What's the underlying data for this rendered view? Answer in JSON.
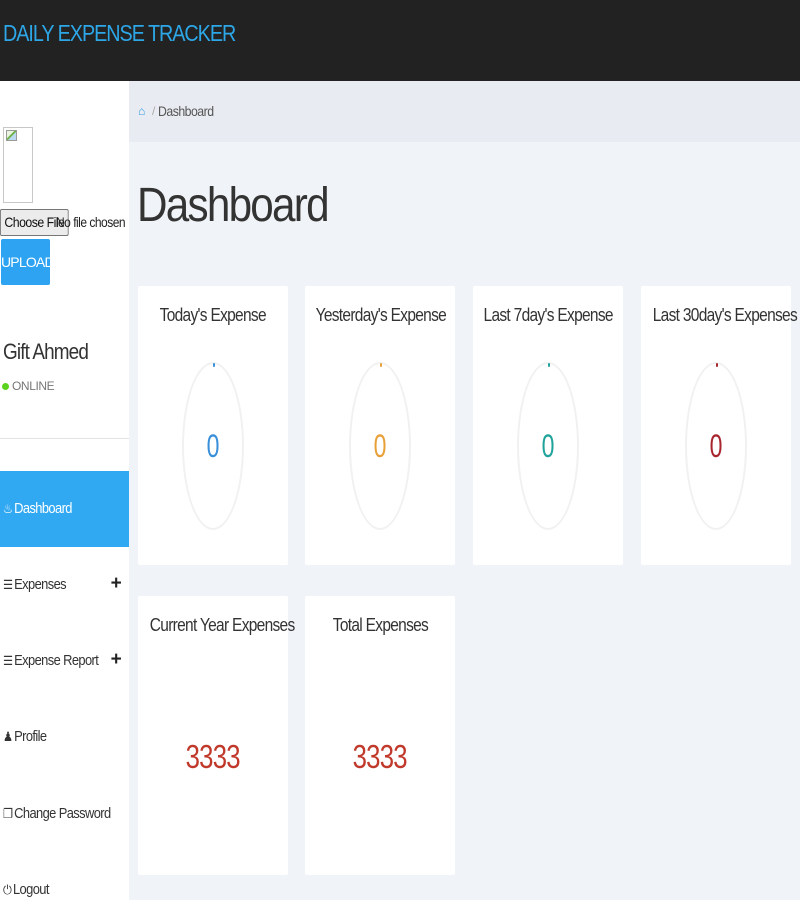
{
  "app": {
    "brand": "DAILY EXPENSE TRACKER"
  },
  "profile": {
    "choose_file_label": "Choose File",
    "file_status": "No file chosen",
    "upload_label": "UPLOAD",
    "user_name": "Gift Ahmed",
    "status": "ONLINE",
    "status_color": "#5bd21e"
  },
  "nav": {
    "items": [
      {
        "label": "Dashboard",
        "icon": "dashboard-icon",
        "active": true,
        "expandable": false
      },
      {
        "label": "Expenses",
        "icon": "list-icon",
        "active": false,
        "expandable": true
      },
      {
        "label": "Expense Report",
        "icon": "list-icon",
        "active": false,
        "expandable": true
      },
      {
        "label": "Profile",
        "icon": "user-icon",
        "active": false,
        "expandable": false
      },
      {
        "label": "Change Password",
        "icon": "copy-icon",
        "active": false,
        "expandable": false
      },
      {
        "label": "Logout",
        "icon": "power-icon",
        "active": false,
        "expandable": false
      }
    ],
    "expand_glyph": "+"
  },
  "breadcrumb": {
    "current": "Dashboard"
  },
  "dashboard": {
    "title": "Dashboard",
    "stat_cards": [
      {
        "title": "Today's Expense",
        "value": "0",
        "color": "#3a8fd9"
      },
      {
        "title": "Yesterday's Expense",
        "value": "0",
        "color": "#e8a13a"
      },
      {
        "title": "Last 7day's Expense",
        "value": "0",
        "color": "#20a39a"
      },
      {
        "title": "Last 30day's Expenses",
        "value": "0",
        "color": "#a8272f"
      }
    ],
    "total_cards": [
      {
        "title": "Current Year Expenses",
        "value": "3333"
      },
      {
        "title": "Total Expenses",
        "value": "3333"
      }
    ],
    "total_value_color": "#c0392b"
  },
  "theme": {
    "accent": "#31a8f2",
    "topbar": "#222222",
    "brand_color": "#2da7e8"
  }
}
